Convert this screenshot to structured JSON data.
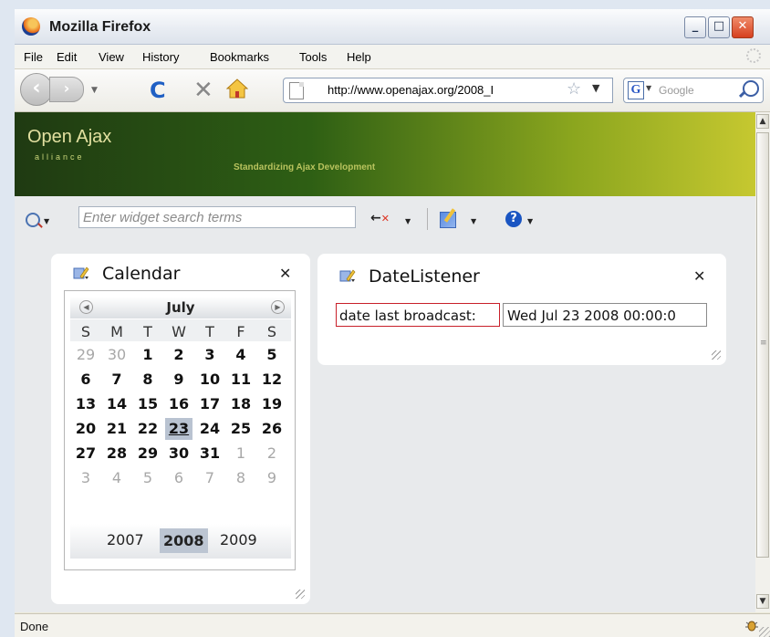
{
  "window": {
    "title": "Mozilla Firefox"
  },
  "window_controls": {
    "minimize": "_",
    "maximize": "□",
    "close": "✕"
  },
  "menu": [
    "File",
    "Edit",
    "View",
    "History",
    "Bookmarks",
    "Tools",
    "Help"
  ],
  "nav": {
    "back_glyph": "‹",
    "forward_glyph": "›",
    "reload_glyph": "C",
    "stop_glyph": "✕",
    "url": "http://www.openajax.org/2008_I",
    "search_engine_letter": "G",
    "search_placeholder": "Google"
  },
  "banner": {
    "logo": "Open Ajax",
    "logo_sub": "alliance",
    "tagline": "Standardizing Ajax Development"
  },
  "widget_toolbar": {
    "search_placeholder": "Enter widget search terms"
  },
  "calendar_widget": {
    "title": "Calendar",
    "close_glyph": "✕",
    "month": "July",
    "prev_glyph": "◀",
    "next_glyph": "▶",
    "weekdays": [
      "S",
      "M",
      "T",
      "W",
      "T",
      "F",
      "S"
    ],
    "weeks": [
      [
        {
          "d": "29",
          "o": true
        },
        {
          "d": "30",
          "o": true
        },
        {
          "d": "1"
        },
        {
          "d": "2"
        },
        {
          "d": "3"
        },
        {
          "d": "4"
        },
        {
          "d": "5"
        }
      ],
      [
        {
          "d": "6"
        },
        {
          "d": "7"
        },
        {
          "d": "8"
        },
        {
          "d": "9"
        },
        {
          "d": "10"
        },
        {
          "d": "11"
        },
        {
          "d": "12"
        }
      ],
      [
        {
          "d": "13"
        },
        {
          "d": "14"
        },
        {
          "d": "15"
        },
        {
          "d": "16"
        },
        {
          "d": "17"
        },
        {
          "d": "18"
        },
        {
          "d": "19"
        }
      ],
      [
        {
          "d": "20"
        },
        {
          "d": "21"
        },
        {
          "d": "22"
        },
        {
          "d": "23",
          "t": true
        },
        {
          "d": "24"
        },
        {
          "d": "25"
        },
        {
          "d": "26"
        }
      ],
      [
        {
          "d": "27"
        },
        {
          "d": "28"
        },
        {
          "d": "29"
        },
        {
          "d": "30"
        },
        {
          "d": "31"
        },
        {
          "d": "1",
          "o": true
        },
        {
          "d": "2",
          "o": true
        }
      ],
      [
        {
          "d": "3",
          "o": true
        },
        {
          "d": "4",
          "o": true
        },
        {
          "d": "5",
          "o": true
        },
        {
          "d": "6",
          "o": true
        },
        {
          "d": "7",
          "o": true
        },
        {
          "d": "8",
          "o": true
        },
        {
          "d": "9",
          "o": true
        }
      ]
    ],
    "years": [
      "2007",
      "2008",
      "2009"
    ],
    "selected_year": "2008"
  },
  "date_listener_widget": {
    "title": "DateListener",
    "close_glyph": "✕",
    "label": "date last broadcast:",
    "value": "Wed Jul 23 2008 00:00:0"
  },
  "status": {
    "text": "Done"
  },
  "colors": {
    "banner_dark": "#1f3a12",
    "banner_light": "#c6c830",
    "selected_day": "#b9c3d1",
    "label_border": "#c8202a"
  }
}
